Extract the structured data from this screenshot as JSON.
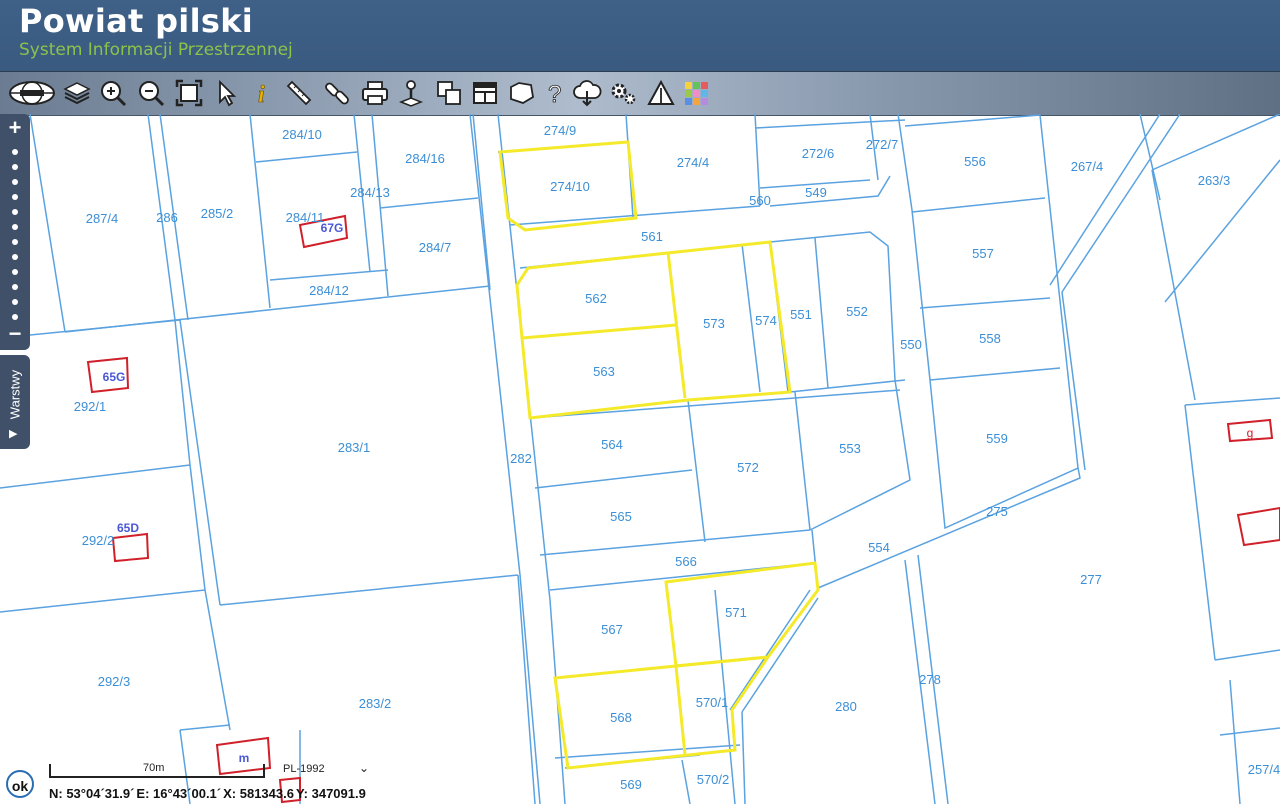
{
  "header": {
    "title": "Powiat pilski",
    "subtitle": "System Informacji Przestrzennej"
  },
  "toolbar": {
    "tools": [
      {
        "name": "logo-globe-icon"
      },
      {
        "name": "layers-icon"
      },
      {
        "name": "zoom-in-icon"
      },
      {
        "name": "zoom-out-icon"
      },
      {
        "name": "full-extent-icon"
      },
      {
        "name": "select-arrow-icon"
      },
      {
        "name": "info-icon"
      },
      {
        "name": "measure-ruler-icon"
      },
      {
        "name": "link-icon"
      },
      {
        "name": "print-icon"
      },
      {
        "name": "locate-parcel-icon"
      },
      {
        "name": "copy-icon"
      },
      {
        "name": "layout-window-icon"
      },
      {
        "name": "area-measure-icon"
      },
      {
        "name": "help-icon"
      },
      {
        "name": "download-cloud-icon"
      },
      {
        "name": "settings-gears-icon"
      },
      {
        "name": "warning-sign-icon"
      },
      {
        "name": "color-grid-icon"
      }
    ]
  },
  "zoom": {
    "plus": "+",
    "minus": "−"
  },
  "layers_tab": {
    "label": "Warstwy",
    "arrow": "▶"
  },
  "map": {
    "colors": {
      "parcel_line": "#5aa2e0",
      "highlight": "#f4ea2a",
      "building": "#d0202a",
      "label": "#3c8fd6"
    },
    "parcel_labels": [
      "274/9",
      "274/10",
      "274/4",
      "272/6",
      "272/7",
      "549",
      "560",
      "561",
      "556",
      "267/4",
      "263/3",
      "284/10",
      "284/16",
      "284/13",
      "284/11",
      "284/7",
      "284/12",
      "287/4",
      "286",
      "285/2",
      "562",
      "573",
      "574",
      "551",
      "552",
      "563",
      "557",
      "558",
      "550",
      "292/1",
      "283/1",
      "282",
      "564",
      "572",
      "553",
      "559",
      "565",
      "275",
      "292/2",
      "554",
      "566",
      "277",
      "571",
      "567",
      "292/3",
      "283/2",
      "280",
      "278",
      "568",
      "570/1",
      "569",
      "570/2",
      "257/4"
    ],
    "building_labels": [
      "67G",
      "65G",
      "65D",
      "g",
      "m"
    ]
  },
  "scale": {
    "label": "70m"
  },
  "crs": {
    "selected": "PL-1992"
  },
  "coords": {
    "lat": "N: 53°04´31.9´",
    "lon": "E: 16°43´00.1´",
    "x": "X: 581343.6",
    "y": "Y: 347091.9"
  },
  "ok_button": "ok"
}
